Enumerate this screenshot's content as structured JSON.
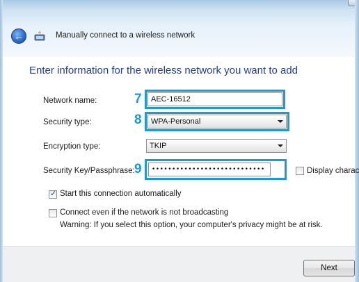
{
  "window": {
    "title": "Manually connect to a wireless network"
  },
  "heading": "Enter information for the wireless network you want to add",
  "form": {
    "network_name": {
      "step": "7",
      "label": "Network name:",
      "value": "AEC-16512"
    },
    "security_type": {
      "step": "8",
      "label": "Security type:",
      "value": "WPA-Personal"
    },
    "encryption_type": {
      "label": "Encryption type:",
      "value": "TKIP"
    },
    "security_key": {
      "step": "9",
      "label": "Security Key/Passphrase:",
      "value": "••••••••••••••••••••••••••••"
    },
    "display_characters": {
      "label": "Display characte",
      "checked": false
    },
    "start_auto": {
      "label": "Start this connection automatically",
      "checked": true
    },
    "connect_hidden": {
      "label": "Connect even if the network is not broadcasting",
      "checked": false,
      "warning": "Warning: If you select this option, your computer's privacy might be at risk."
    }
  },
  "buttons": {
    "next": "Next"
  },
  "colors": {
    "heading": "#1f3f8f",
    "highlight": "#1a9ad6",
    "step_number": "#1a9ad6"
  },
  "icons": {
    "back": "back-arrow-icon",
    "network": "wireless-network-icon",
    "dropdown": "chevron-down-icon",
    "check": "checkmark-icon"
  }
}
